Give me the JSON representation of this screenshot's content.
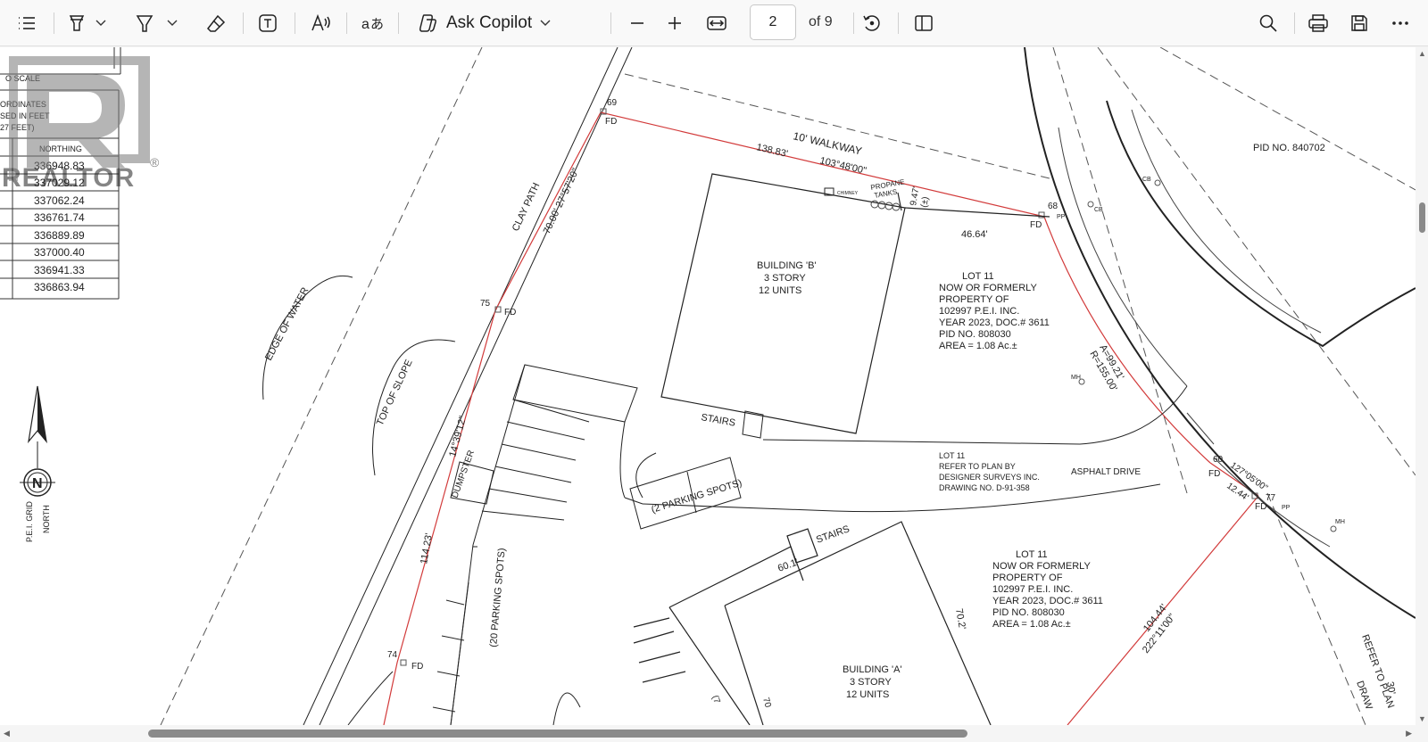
{
  "toolbar": {
    "ask_copilot_label": "Ask Copilot",
    "page_current": "2",
    "page_total_label": "of 9",
    "icons": [
      "contents-icon",
      "highlight-icon",
      "draw-icon",
      "eraser-icon",
      "text-icon",
      "read-aloud-icon",
      "translate-icon",
      "copilot-icon",
      "zoom-out-icon",
      "zoom-in-icon",
      "fit-width-icon",
      "rotate-icon",
      "page-view-icon",
      "search-icon",
      "print-icon",
      "save-icon",
      "more-icon"
    ]
  },
  "watermark": {
    "text": "REALTOR",
    "mark": "®"
  },
  "coords_table": {
    "header_lines": [
      "O SCALE",
      "ORDINATES",
      "SED IN FEET",
      "27 FEET)"
    ],
    "column_header": "NORTHING",
    "rows": [
      "336948.83",
      "337029.12",
      "337062.24",
      "336761.74",
      "336889.89",
      "337000.40",
      "336941.33",
      "336863.94"
    ]
  },
  "north_arrow": {
    "letter": "N",
    "grid_label": "P.E.I. GRID",
    "north_label": "NORTH"
  },
  "plan": {
    "walkway": "10' WALKWAY",
    "bearing_top_1": "138.83'",
    "bearing_top_2": "103°48'00\"",
    "chimney": "CHIMNEY",
    "propane": "PROPANE",
    "tanks": "TANKS",
    "dim_9_47": "9.47'",
    "dim_pm": "(±)",
    "dim_46_64": "46.64'",
    "pt_69": "69",
    "pt_68": "68",
    "pt_75": "75",
    "pt_74": "74",
    "pt_60": "60",
    "pt_77": "77",
    "fd": "FD",
    "clay_path": "CLAY PATH",
    "dim_70_00": "70.00' 27°57'20\"",
    "edge_of_water": "EDGE OF WATER",
    "top_of_slope": "TOP OF SLOPE",
    "angle_14_39": "14°39'12\"",
    "dumpster": "DUMPSTER",
    "dim_114_23": "114.23'",
    "bldg_b": [
      "BUILDING 'B'",
      "3 STORY",
      "12 UNITS"
    ],
    "bldg_a": [
      "BUILDING 'A'",
      "3 STORY",
      "12 UNITS"
    ],
    "stairs_1": "STAIRS",
    "stairs_2": "STAIRS",
    "parking_2": "(2 PARKING SPOTS)",
    "parking_20": "(20 PARKING SPOTS)",
    "parking_7": "(7",
    "lot11_block_1": [
      "LOT 11",
      "NOW OR FORMERLY",
      "PROPERTY OF",
      "102997 P.E.I. INC.",
      "YEAR 2023, DOC.# 3611",
      "PID NO. 808030",
      "AREA = 1.08 Ac.±"
    ],
    "lot11_block_2": [
      "LOT 11",
      "NOW OR FORMERLY",
      "PROPERTY OF",
      "102997 P.E.I. INC.",
      "YEAR 2023, DOC.# 3611",
      "PID NO. 808030",
      "AREA = 1.08 Ac.±"
    ],
    "lot11_refer": [
      "LOT 11",
      "REFER TO PLAN BY",
      "DESIGNER SURVEYS INC.",
      "DRAWING NO. D-91-358"
    ],
    "asphalt_drive": "ASPHALT DRIVE",
    "pid_840702": "PID NO. 840702",
    "r_155": "R=155.00'",
    "a_99_21": "A=99.21'",
    "b_127": "127°05'00\"",
    "d_12_44": "12.44'",
    "d_104_44": "104.44'",
    "b_222": "222°11'00\"",
    "d_60_1": "60.1'",
    "d_70_2": "70.2'",
    "mh": "MH",
    "cb": "CB",
    "pp": "PP",
    "refer_to_plan": "REFER TO PLAN",
    "draw": "DRAW",
    "dim_30": "30'",
    "d_70_partial": "70"
  }
}
